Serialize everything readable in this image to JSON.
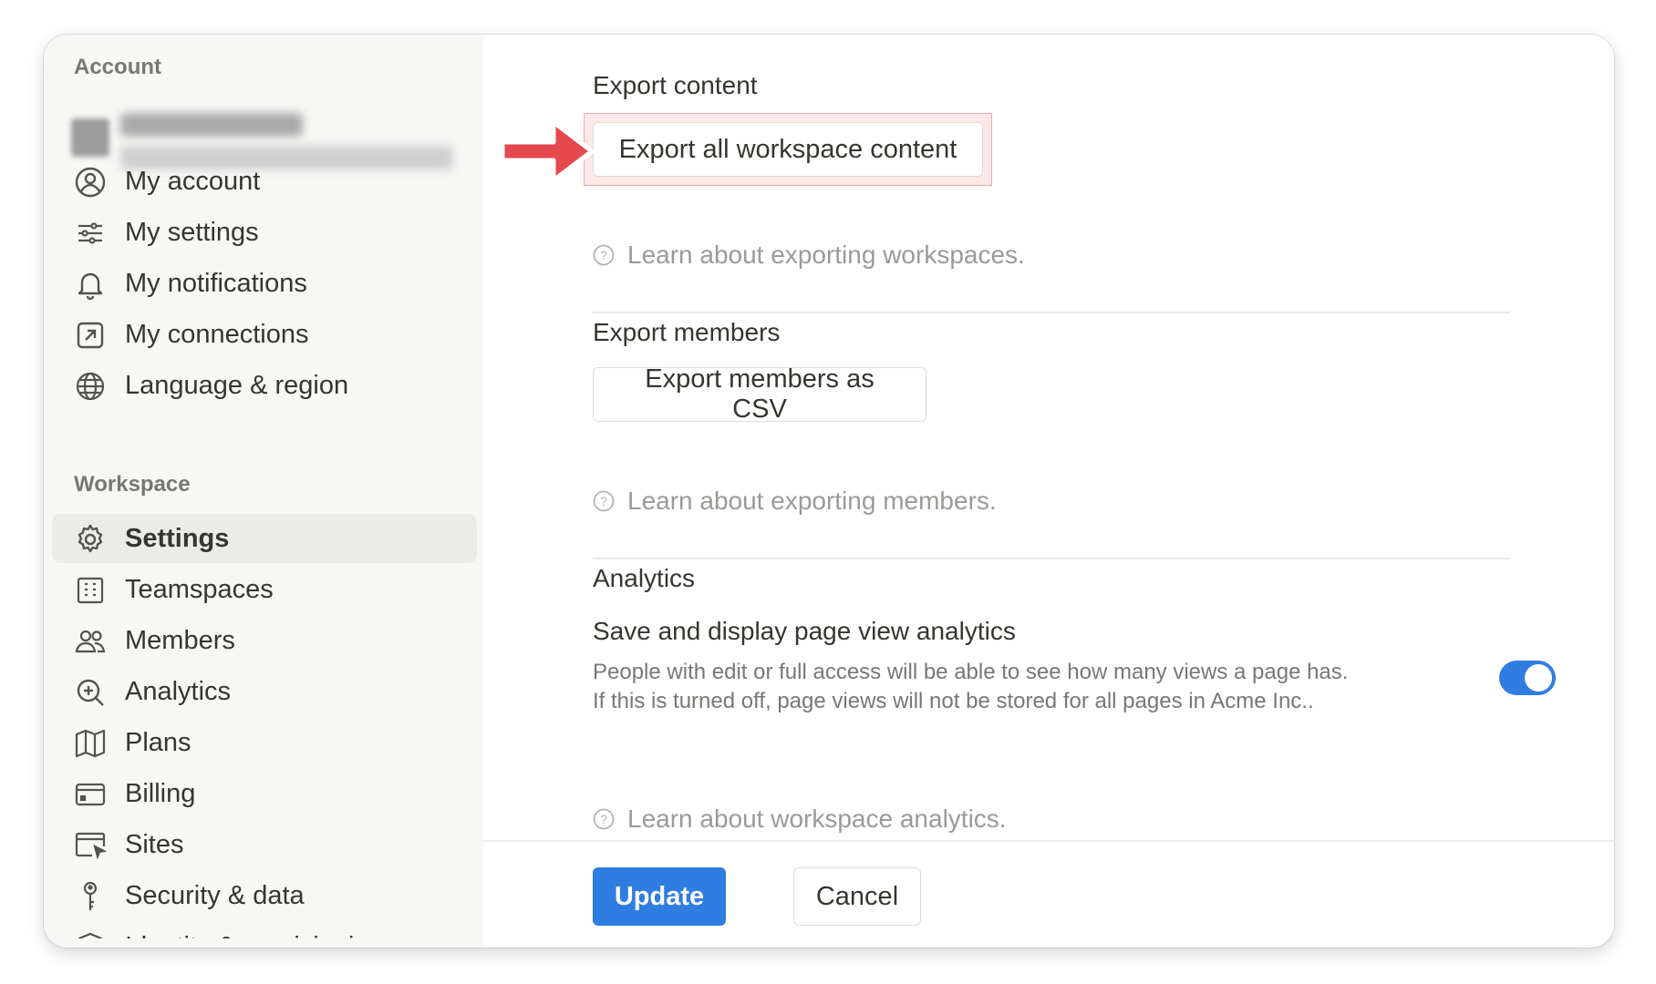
{
  "sidebar": {
    "account_label": "Account",
    "account_items": [
      {
        "label": "My account",
        "icon": "user-circle-icon"
      },
      {
        "label": "My settings",
        "icon": "sliders-icon"
      },
      {
        "label": "My notifications",
        "icon": "bell-icon"
      },
      {
        "label": "My connections",
        "icon": "external-link-icon"
      },
      {
        "label": "Language & region",
        "icon": "globe-icon"
      }
    ],
    "workspace_label": "Workspace",
    "workspace_items": [
      {
        "label": "Settings",
        "icon": "gear-icon",
        "active": true
      },
      {
        "label": "Teamspaces",
        "icon": "building-icon"
      },
      {
        "label": "Members",
        "icon": "users-icon"
      },
      {
        "label": "Analytics",
        "icon": "magnify-plus-icon"
      },
      {
        "label": "Plans",
        "icon": "map-icon"
      },
      {
        "label": "Billing",
        "icon": "credit-card-icon"
      },
      {
        "label": "Sites",
        "icon": "browser-cursor-icon"
      },
      {
        "label": "Security & data",
        "icon": "key-icon"
      },
      {
        "label": "Identity & provisioning",
        "icon": "shield-icon"
      }
    ]
  },
  "main": {
    "export_content": {
      "title": "Export content",
      "button": "Export all workspace content",
      "help": "Learn about exporting workspaces."
    },
    "export_members": {
      "title": "Export members",
      "button": "Export members as CSV",
      "help": "Learn about exporting members."
    },
    "analytics": {
      "title": "Analytics",
      "setting_title": "Save and display page view analytics",
      "setting_desc": "People with edit or full access will be able to see how many views a page has. If this is turned off, page views will not be stored for all pages in Acme Inc..",
      "toggle_on": true,
      "help": "Learn about workspace analytics."
    }
  },
  "footer": {
    "update_label": "Update",
    "cancel_label": "Cancel"
  },
  "colors": {
    "accent": "#2f7de1",
    "highlight_arrow": "#e5484d"
  }
}
